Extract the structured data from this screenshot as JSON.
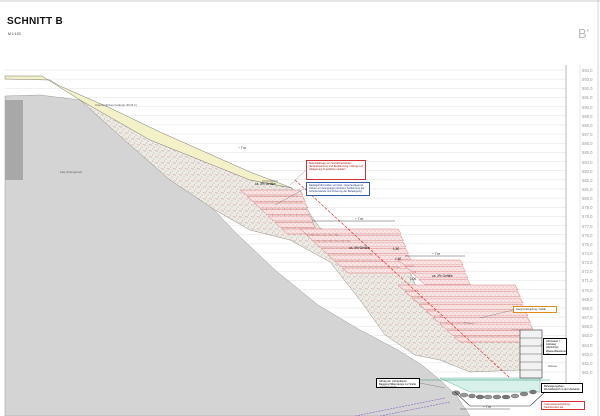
{
  "title": "SCHNITT B",
  "scale": "M 1:100",
  "section_mark": "B'",
  "elevations": [
    "594,0",
    "593,0",
    "592,0",
    "591,0",
    "590,0",
    "589,0",
    "588,0",
    "587,0",
    "586,0",
    "585,0",
    "584,0",
    "583,0",
    "582,0",
    "581,0",
    "580,0",
    "579,0",
    "578,0",
    "577,0",
    "576,0",
    "575,0",
    "574,0",
    "573,0",
    "572,0",
    "571,0",
    "570,0",
    "569,0",
    "568,0",
    "567,0",
    "566,0",
    "565,0",
    "564,0",
    "563,0",
    "562,0",
    "561,0"
  ],
  "notes": {
    "red_top": "Materialabtrag von Gehölzbeständen (Erdsubstanzen) und Bepflanzung / Abtrag und Ablagerung in seitlichen Halden",
    "blue_mid": "Nadelgehölzmulden verrottet, zwischenlagernd, Anbau von Hangnagel überbaut; Aufkantung der Schotterwände und Fixierung der Befestigung",
    "orange_right": "Hangversiegelung / Halde",
    "black_right": "Ufermauer / Holzsteg Uferschutz; Wasserbausteine als Uferböschung Unterwasser",
    "black_bottom": "Abtrag der vorhandenen Baggerschlittenrampe zur Sohle und Uferschutz",
    "black_bottom_right": "Befestigungsbau; Wurzelbereich in der Uferkante",
    "red_bottom_right": "Unterwasserschüttung: Steinbrocken als Gesteinsverbund / Sohlsicherung"
  },
  "small_labels": {
    "gelaende": "Ursprüngliches Gelände (Profil C)",
    "fels": "Fels (Untergrund)",
    "dim_7m_upper": "~ 7 m",
    "dim_7m_mid": "~ 7 m",
    "dim_7m_low": "~ 7 m",
    "dim_7m_bottom": "~ 7 m",
    "gefaelle_1": "ca. 3% Gefälle",
    "gefaelle_2": "ca. 3% Gefälle",
    "gefaelle_3": "ca. 3% Gefälle",
    "dim_150": "1,50",
    "dim_100": "1,00",
    "dim_160": "1,60",
    "water_label": "Wasser"
  },
  "colors": {
    "rock": "#d6d6d6",
    "topsoil": "#f2f1c8",
    "fill_speckle": "#e9e4df",
    "terrace": "#f7dede",
    "water": "#dcf2ec",
    "note_red": "#d43030",
    "note_blue": "#3a57a8",
    "note_orange": "#e08a1a"
  }
}
